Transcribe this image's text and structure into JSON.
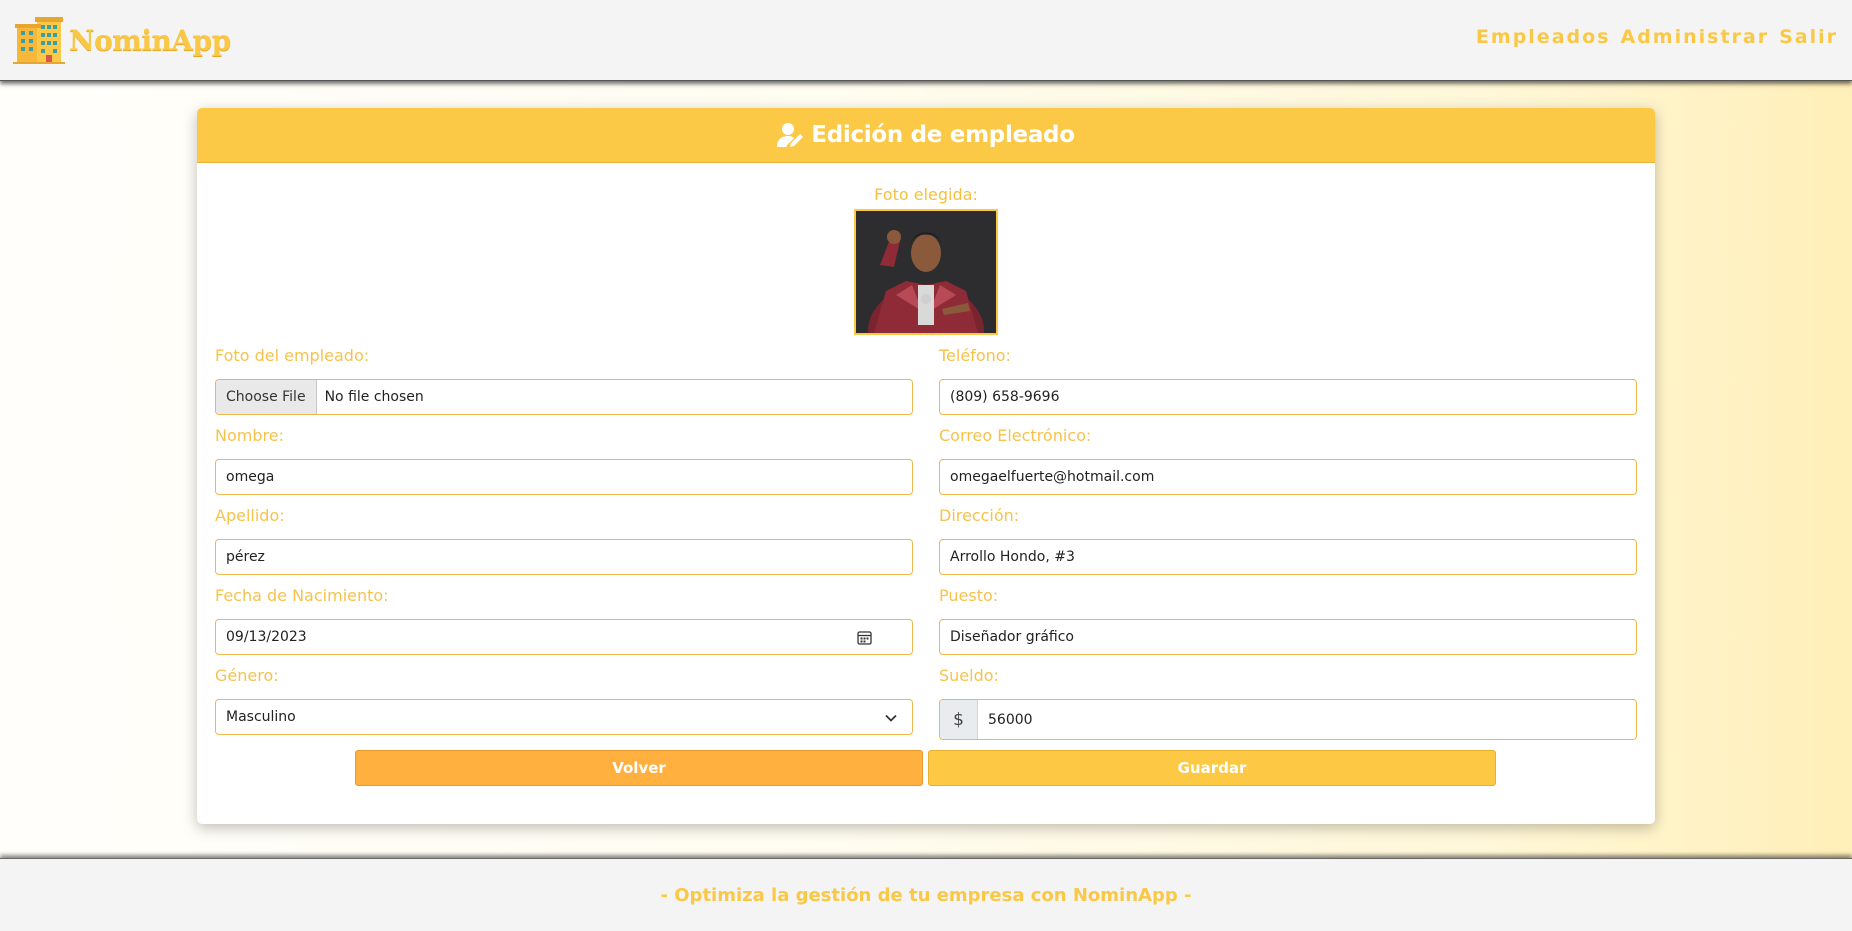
{
  "app": {
    "name": "NominApp",
    "accent": "#fcc947",
    "logo_icon": "building-icon"
  },
  "nav": {
    "items": [
      {
        "label": "Empleados"
      },
      {
        "label": "Administrar"
      },
      {
        "label": "Salir"
      }
    ]
  },
  "card": {
    "title": "Edición de empleado",
    "title_icon": "user-edit-icon",
    "photo_label": "Foto elegida:"
  },
  "form": {
    "photo": {
      "label": "Foto del empleado:",
      "button": "Choose File",
      "status": "No file chosen"
    },
    "nombre": {
      "label": "Nombre:",
      "value": "omega"
    },
    "apellido": {
      "label": "Apellido:",
      "value": "pérez"
    },
    "fecha": {
      "label": "Fecha de Nacimiento:",
      "value": "09/13/2023"
    },
    "genero": {
      "label": "Género:",
      "value": "Masculino"
    },
    "telefono": {
      "label": "Teléfono:",
      "value": "(809) 658-9696"
    },
    "correo": {
      "label": "Correo Electrónico:",
      "value": "omegaelfuerte@hotmail.com"
    },
    "direccion": {
      "label": "Dirección:",
      "value": "Arrollo Hondo, #3"
    },
    "puesto": {
      "label": "Puesto:",
      "value": "Diseñador gráfico"
    },
    "sueldo": {
      "label": "Sueldo:",
      "currency": "$",
      "value": "56000"
    }
  },
  "buttons": {
    "back": "Volver",
    "save": "Guardar"
  },
  "footer": {
    "text": "- Optimiza la gestión de tu empresa con NominApp -"
  }
}
